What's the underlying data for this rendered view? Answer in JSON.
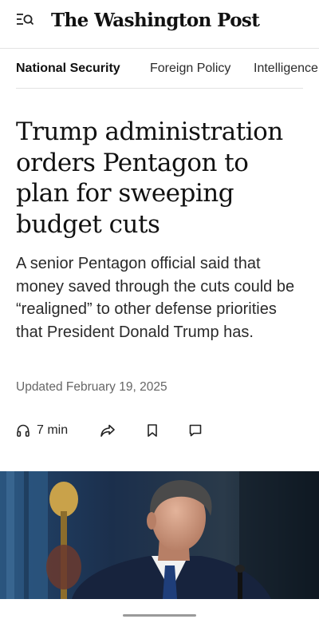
{
  "header": {
    "logo_text": "The Washington Post",
    "menu_icon": "menu-search-icon"
  },
  "tabs": [
    {
      "label": "National Security",
      "active": true
    },
    {
      "label": "Foreign Policy",
      "active": false
    },
    {
      "label": "Intelligence",
      "active": false
    }
  ],
  "article": {
    "headline": "Trump administration orders Pentagon to plan for sweeping budget cuts",
    "dek": "A senior Pentagon official said that money saved through the cuts could be “realigned” to other defense priorities that President Donald Trump has.",
    "updated": "Updated February 19, 2025"
  },
  "actions": {
    "listen_label": "7 min",
    "icons": [
      "headphones-icon",
      "share-icon",
      "bookmark-icon",
      "comment-icon"
    ]
  },
  "colors": {
    "text": "#111111",
    "muted": "#666666",
    "divider": "#e3e3e3",
    "photo_background": "#1e3350",
    "suit": "#17233d"
  }
}
